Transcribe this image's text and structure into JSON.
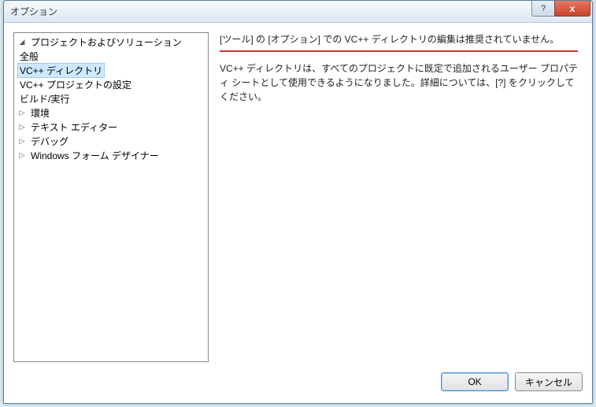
{
  "window": {
    "title": "オプション"
  },
  "titlebar": {
    "help": "?",
    "close": "x"
  },
  "tree": {
    "items": [
      {
        "label": "プロジェクトおよびソリューション",
        "expanded": true,
        "children": [
          {
            "label": "全般"
          },
          {
            "label": "VC++ ディレクトリ",
            "selected": true
          },
          {
            "label": "VC++ プロジェクトの設定"
          },
          {
            "label": "ビルド/実行"
          }
        ]
      },
      {
        "label": "環境",
        "expanded": false
      },
      {
        "label": "テキスト エディター",
        "expanded": false
      },
      {
        "label": "デバッグ",
        "expanded": false
      },
      {
        "label": "Windows フォーム デザイナー",
        "expanded": false
      }
    ]
  },
  "detail": {
    "warning": "[ツール] の [オプション] での VC++ ディレクトリの編集は推奨されていません。",
    "body": "VC++ ディレクトリは、すべてのプロジェクトに既定で追加されるユーザー プロパティ シートとして使用できるようになりました。詳細については、[?] をクリックしてください。"
  },
  "buttons": {
    "ok": "OK",
    "cancel": "キャンセル"
  }
}
